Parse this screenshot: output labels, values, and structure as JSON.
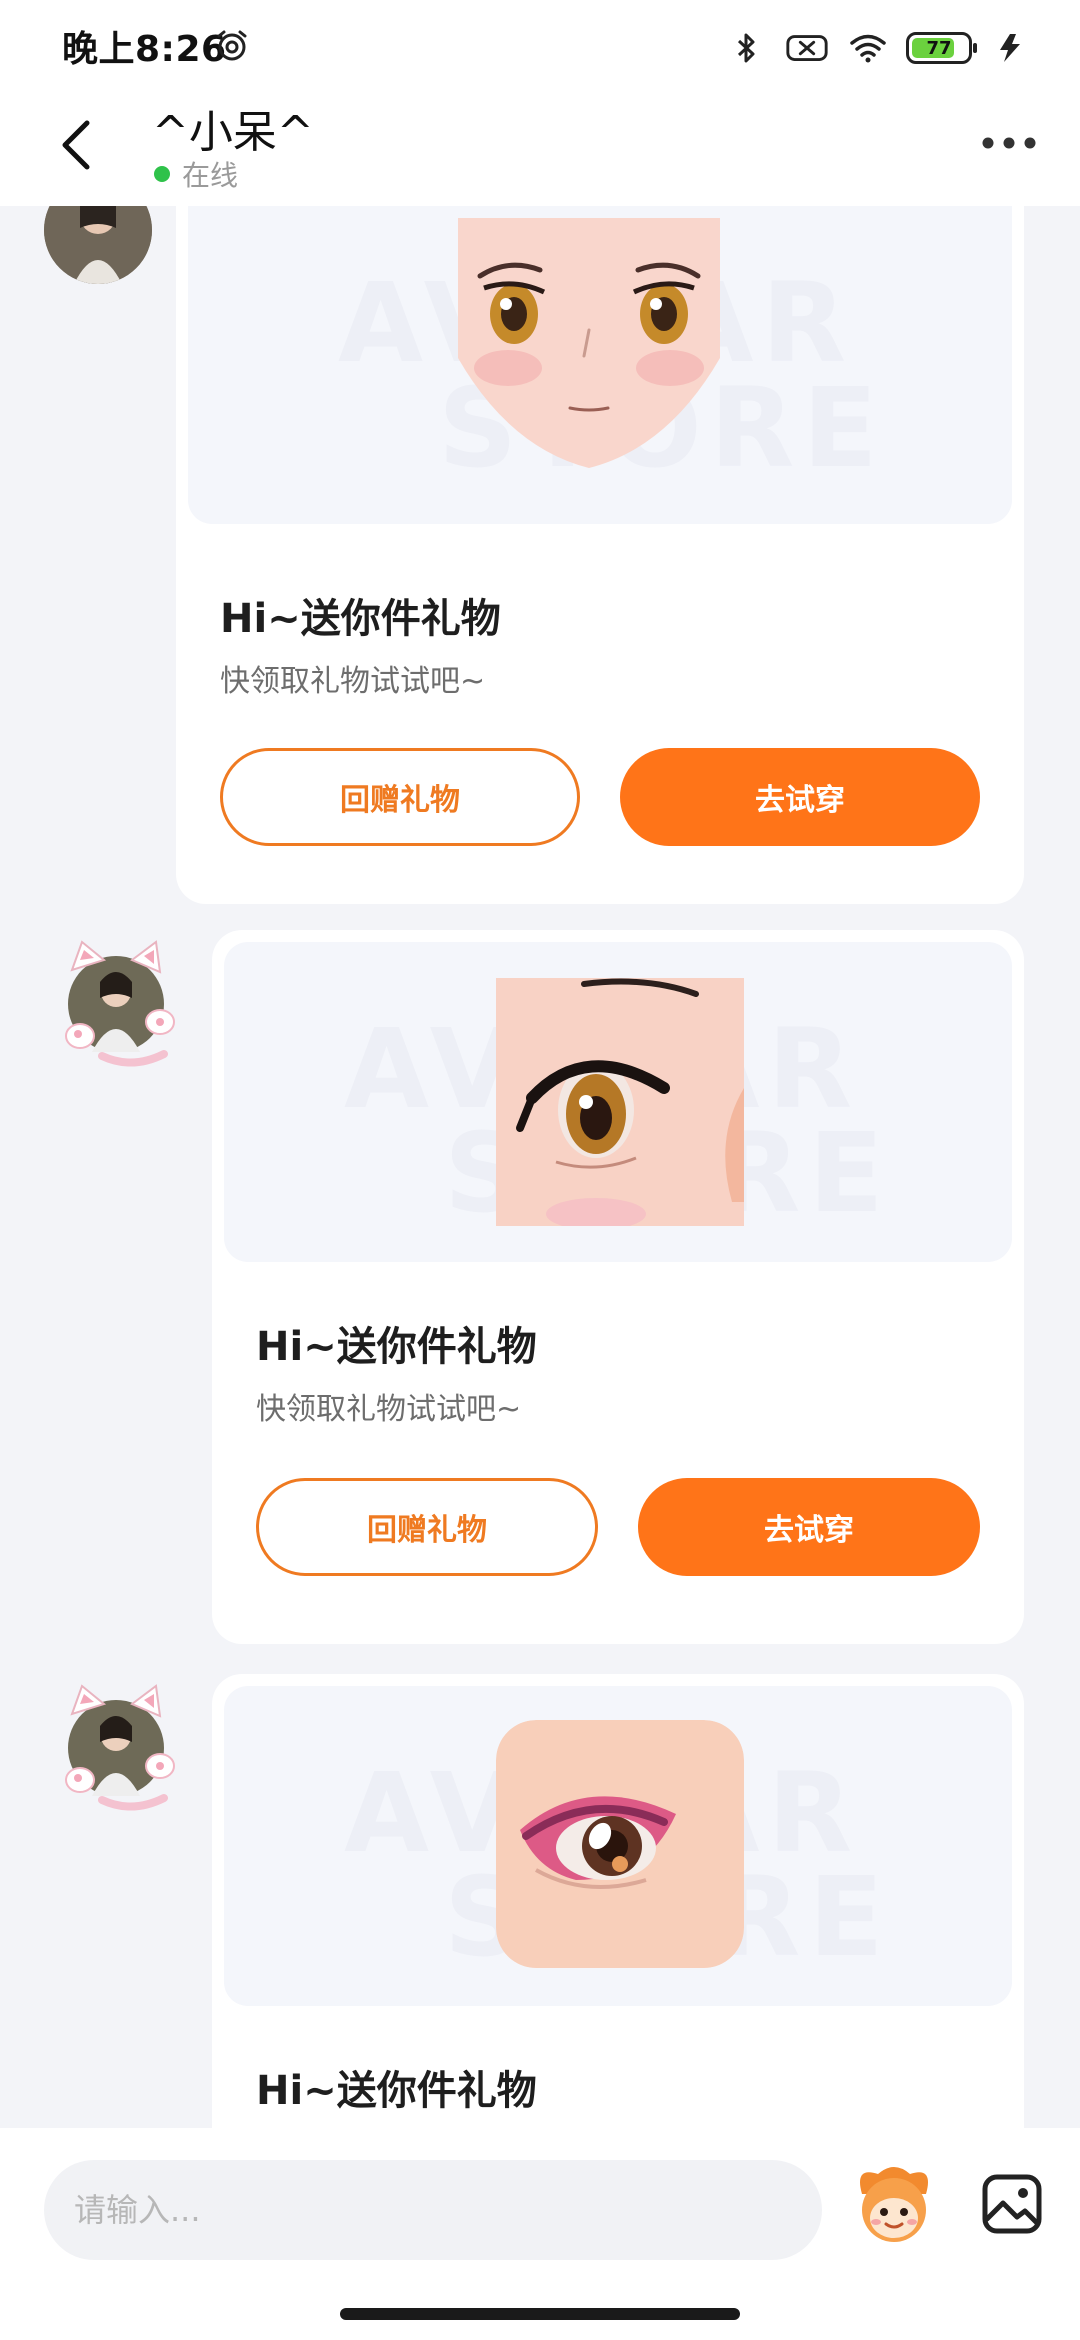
{
  "status_bar": {
    "time": "晚上8:26",
    "battery": "77",
    "battery_level": 0.77,
    "icons": [
      "alarm-icon",
      "bluetooth-icon",
      "sim-off-icon",
      "wifi-icon",
      "battery-icon",
      "charging-icon"
    ]
  },
  "header": {
    "contact_name": "^小呆^",
    "presence": "在线",
    "presence_color": "#2fc24a",
    "back_icon": "chevron-left-icon",
    "more_icon": "more-dots-icon"
  },
  "watermark_line1": "AVATAR",
  "watermark_line2": "STORE",
  "messages": [
    {
      "gift": "face",
      "title": "Hi~送你件礼物",
      "subtitle": "快领取礼物试试吧~",
      "return_label": "回赠礼物",
      "try_label": "去试穿"
    },
    {
      "gift": "eye",
      "title": "Hi~送你件礼物",
      "subtitle": "快领取礼物试试吧~",
      "return_label": "回赠礼物",
      "try_label": "去试穿"
    },
    {
      "gift": "eyeshadow",
      "title": "Hi~送你件礼物"
    }
  ],
  "input_bar": {
    "placeholder": "请输入...",
    "mascot_icon": "mascot-icon",
    "image_icon": "image-icon"
  },
  "colors": {
    "accent": "#ff7418",
    "accent_outline": "#ef7a21",
    "background": "#f3f4f8"
  }
}
